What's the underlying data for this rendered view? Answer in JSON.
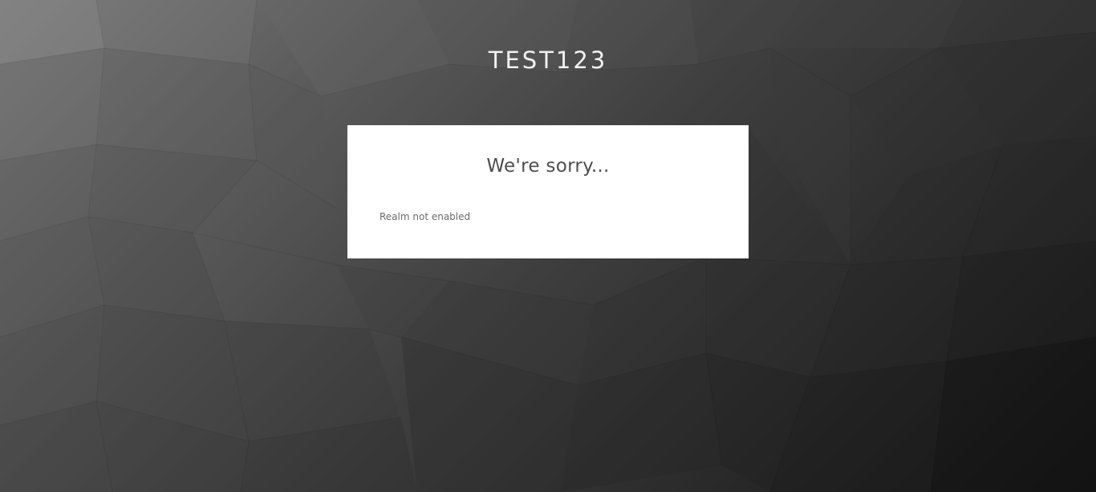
{
  "realm": {
    "title": "TEST123"
  },
  "error_card": {
    "heading": "We're sorry...",
    "message": "Realm not enabled"
  },
  "colors": {
    "card_background": "#ffffff",
    "title_text": "#f2f2f2",
    "heading_text": "#4d4d4d",
    "message_text": "#6a6a6a",
    "background_light": "#7d7d7d",
    "background_dark": "#141414"
  }
}
